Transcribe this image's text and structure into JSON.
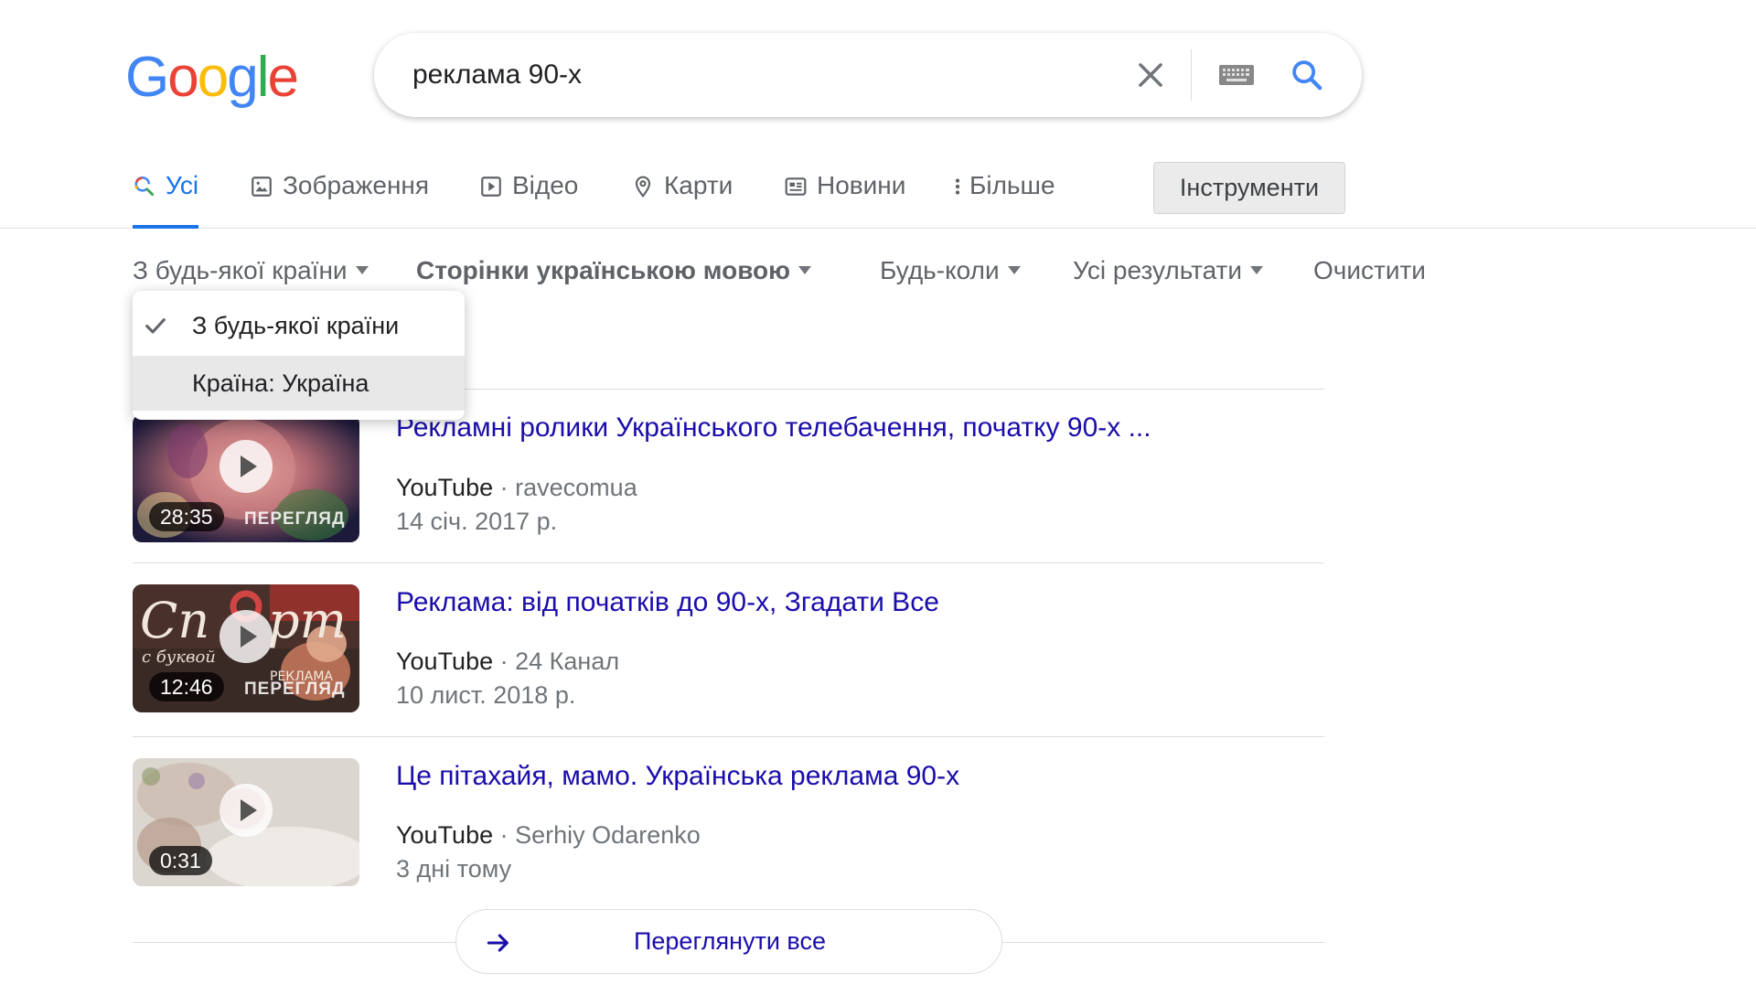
{
  "logo": {
    "letters": [
      "G",
      "o",
      "o",
      "g",
      "l",
      "e"
    ],
    "colors": [
      "#4285f4",
      "#ea4335",
      "#fbbc05",
      "#4285f4",
      "#34a853",
      "#ea4335"
    ]
  },
  "search": {
    "query": "реклама 90-х",
    "icons": [
      "close-icon",
      "keyboard-icon",
      "search-icon"
    ]
  },
  "tabs": [
    {
      "label": "Усі",
      "icon": "search-icon",
      "active": true
    },
    {
      "label": "Зображення",
      "icon": "image-icon"
    },
    {
      "label": "Відео",
      "icon": "video-icon"
    },
    {
      "label": "Карти",
      "icon": "map-pin-icon"
    },
    {
      "label": "Новини",
      "icon": "news-icon"
    },
    {
      "label": "Більше",
      "icon": "more-vert-icon"
    }
  ],
  "tools_label": "Інструменти",
  "filters": [
    {
      "label": "З будь-якої країни"
    },
    {
      "label": "Сторінки українською мовою"
    },
    {
      "label": "Будь-коли"
    },
    {
      "label": "Усі результати"
    },
    {
      "label": "Очистити"
    }
  ],
  "country_menu": {
    "items": [
      {
        "label": "З будь-якої країни",
        "checked": true
      },
      {
        "label": "Країна: Україна",
        "hovered": true
      }
    ]
  },
  "results": [
    {
      "title": "Рекламні ролики Українського телебачення, початку 90-х ...",
      "source": "YouTube",
      "separator": "·",
      "channel": "ravecomua",
      "date": "14 січ. 2017 р.",
      "duration": "28:35",
      "preview": "ПЕРЕГЛЯД"
    },
    {
      "title": "Реклама: від початків до 90-х, Згадати Все",
      "source": "YouTube",
      "separator": "·",
      "channel": "24 Канал",
      "date": "10 лист. 2018 р.",
      "duration": "12:46",
      "preview": "ПЕРЕГЛЯД"
    },
    {
      "title": "Це пітахайя, мамо. Українська реклама 90-х",
      "source": "YouTube",
      "separator": "·",
      "channel": "Serhiy Odarenko",
      "date": "3 дні тому",
      "duration": "0:31"
    }
  ],
  "view_all_label": "Переглянути все"
}
